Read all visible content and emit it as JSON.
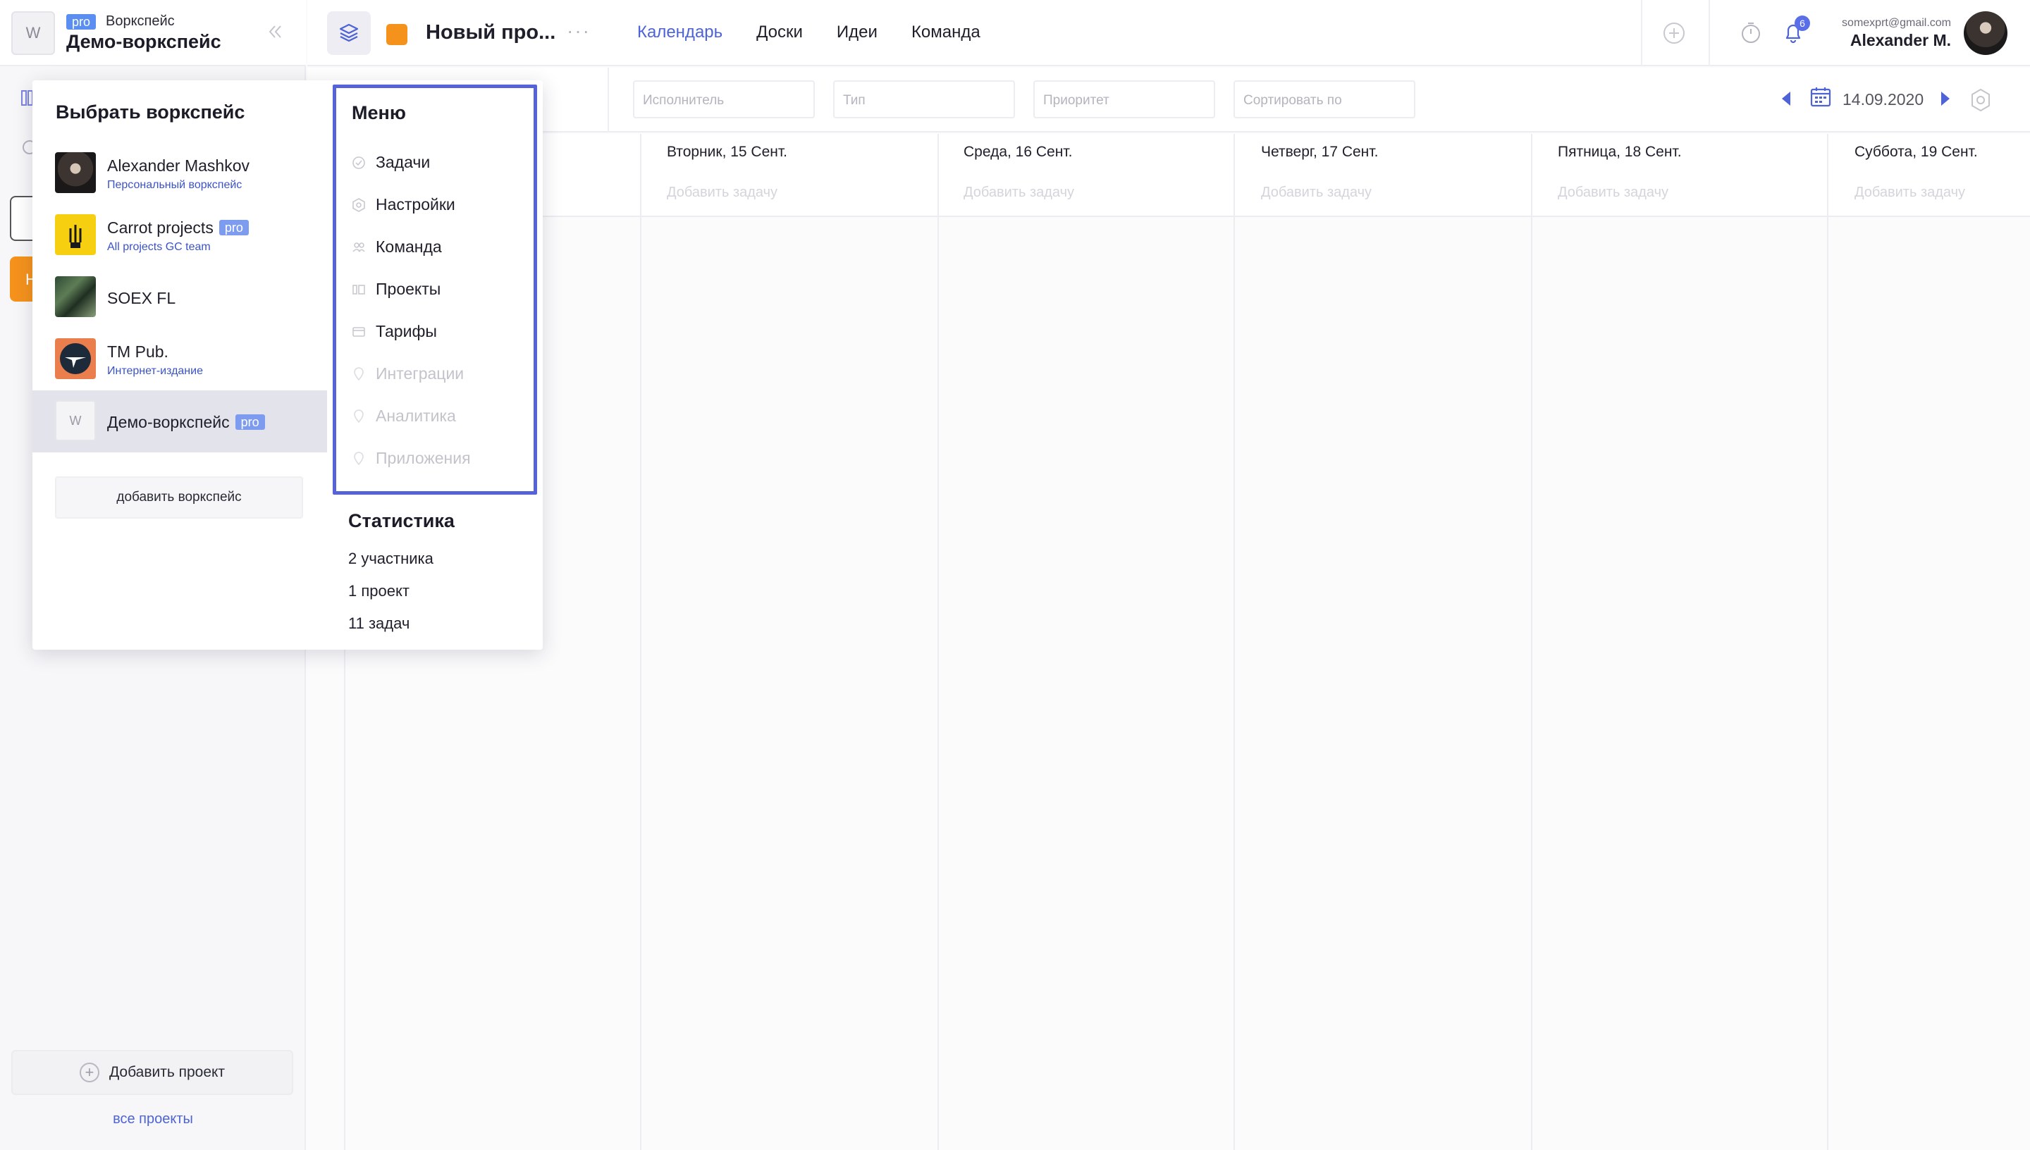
{
  "workspace": {
    "badge": "pro",
    "label": "Воркспейс",
    "name": "Демо-воркспейс",
    "logo_letter": "W"
  },
  "sidebar": {
    "orange_letter": "Н",
    "add_project": "Добавить проект",
    "all_projects": "все проекты"
  },
  "topbar": {
    "project_name": "Новый про...",
    "project_color": "#f5921c",
    "more": "···",
    "tabs": [
      {
        "label": "Календарь",
        "active": true
      },
      {
        "label": "Доски",
        "active": false
      },
      {
        "label": "Идеи",
        "active": false
      },
      {
        "label": "Команда",
        "active": false
      }
    ],
    "notification_count": "6",
    "user_email": "somexprt@gmail.com",
    "user_name": "Alexander M."
  },
  "filters": {
    "assignee": "Исполнитель",
    "type": "Тип",
    "priority": "Приоритет",
    "sort": "Сортировать по",
    "date": "14.09.2020"
  },
  "calendar": {
    "days": [
      {
        "title": "Вторник, 15 Сент.",
        "add": "Добавить задачу"
      },
      {
        "title": "Среда, 16 Сент.",
        "add": "Добавить задачу"
      },
      {
        "title": "Четверг, 17 Сент.",
        "add": "Добавить задачу"
      },
      {
        "title": "Пятница, 18 Сент.",
        "add": "Добавить задачу"
      },
      {
        "title": "Суббота, 19 Сент.",
        "add": "Добавить задачу"
      }
    ]
  },
  "panel": {
    "title": "Выбрать воркспейс",
    "workspaces": [
      {
        "name": "Alexander Mashkov",
        "subtitle": "Персональный воркспейс",
        "pro": ""
      },
      {
        "name": "Carrot projects",
        "subtitle": "All projects GC team",
        "pro": "pro"
      },
      {
        "name": "SOEX FL",
        "subtitle": "",
        "pro": ""
      },
      {
        "name": "TM Pub.",
        "subtitle": "Интернет-издание",
        "pro": ""
      },
      {
        "name": "Демо-воркспейс",
        "subtitle": "",
        "pro": "pro",
        "selected": true
      }
    ],
    "add_workspace": "добавить воркспейс",
    "menu_title": "Меню",
    "menu": [
      {
        "label": "Задачи",
        "icon": "check-circle-icon",
        "enabled": true
      },
      {
        "label": "Настройки",
        "icon": "hexagon-gear-icon",
        "enabled": true
      },
      {
        "label": "Команда",
        "icon": "team-icon",
        "enabled": true
      },
      {
        "label": "Проекты",
        "icon": "projects-icon",
        "enabled": true
      },
      {
        "label": "Тарифы",
        "icon": "card-icon",
        "enabled": true
      },
      {
        "label": "Интеграции",
        "icon": "pin-icon",
        "enabled": false
      },
      {
        "label": "Аналитика",
        "icon": "pin-icon",
        "enabled": false
      },
      {
        "label": "Приложения",
        "icon": "pin-icon",
        "enabled": false
      }
    ],
    "stats_title": "Статистика",
    "stats": [
      "2 участника",
      "1 проект",
      "11 задач"
    ]
  }
}
